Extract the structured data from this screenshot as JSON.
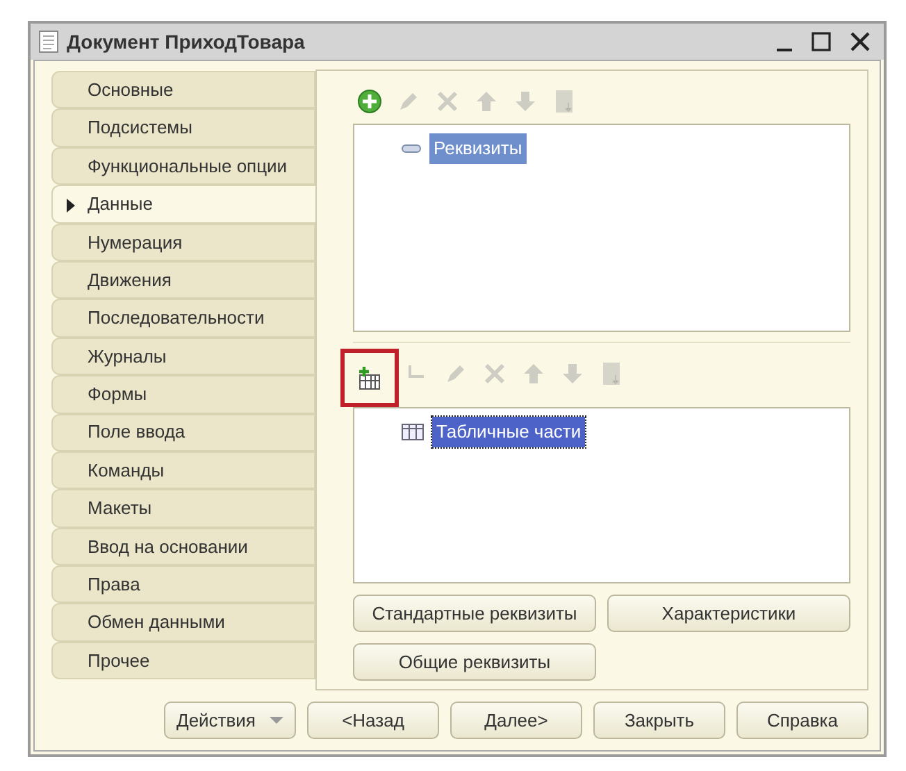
{
  "window": {
    "title": "Документ ПриходТовара"
  },
  "tabs": [
    {
      "label": "Основные",
      "selected": false
    },
    {
      "label": "Подсистемы",
      "selected": false
    },
    {
      "label": "Функциональные опции",
      "selected": false
    },
    {
      "label": "Данные",
      "selected": true
    },
    {
      "label": "Нумерация",
      "selected": false
    },
    {
      "label": "Движения",
      "selected": false
    },
    {
      "label": "Последовательности",
      "selected": false
    },
    {
      "label": "Журналы",
      "selected": false
    },
    {
      "label": "Формы",
      "selected": false
    },
    {
      "label": "Поле ввода",
      "selected": false
    },
    {
      "label": "Команды",
      "selected": false
    },
    {
      "label": "Макеты",
      "selected": false
    },
    {
      "label": "Ввод на основании",
      "selected": false
    },
    {
      "label": "Права",
      "selected": false
    },
    {
      "label": "Обмен данными",
      "selected": false
    },
    {
      "label": "Прочее",
      "selected": false
    }
  ],
  "attributes": {
    "toolbar": [
      {
        "kind": "add",
        "disabled": false,
        "highlighted": false
      },
      {
        "kind": "edit",
        "disabled": true,
        "highlighted": false
      },
      {
        "kind": "delete",
        "disabled": true,
        "highlighted": false
      },
      {
        "kind": "up",
        "disabled": true,
        "highlighted": false
      },
      {
        "kind": "down",
        "disabled": true,
        "highlighted": false
      },
      {
        "kind": "sort",
        "disabled": true,
        "highlighted": false
      }
    ],
    "tree": [
      {
        "kind": "group",
        "label": "Реквизиты",
        "expanded": true,
        "selected": true,
        "focused": false
      }
    ]
  },
  "tabular_sections": {
    "toolbar": [
      {
        "kind": "add-table",
        "disabled": false,
        "highlighted": true
      },
      {
        "kind": "indent",
        "disabled": true,
        "highlighted": false
      },
      {
        "kind": "edit",
        "disabled": true,
        "highlighted": false
      },
      {
        "kind": "delete",
        "disabled": true,
        "highlighted": false
      },
      {
        "kind": "up",
        "disabled": true,
        "highlighted": false
      },
      {
        "kind": "down",
        "disabled": true,
        "highlighted": false
      },
      {
        "kind": "sort",
        "disabled": true,
        "highlighted": false
      }
    ],
    "tree": [
      {
        "kind": "table",
        "label": "Табличные части",
        "selected": true,
        "focused": true
      }
    ]
  },
  "panel_buttons": [
    "Стандартные реквизиты",
    "Характеристики",
    "Общие реквизиты"
  ],
  "footer_buttons": [
    {
      "label": "Действия",
      "dropdown": true
    },
    {
      "label": "<Назад",
      "dropdown": false
    },
    {
      "label": "Далее>",
      "dropdown": false
    },
    {
      "label": "Закрыть",
      "dropdown": false
    },
    {
      "label": "Справка",
      "dropdown": false
    }
  ]
}
